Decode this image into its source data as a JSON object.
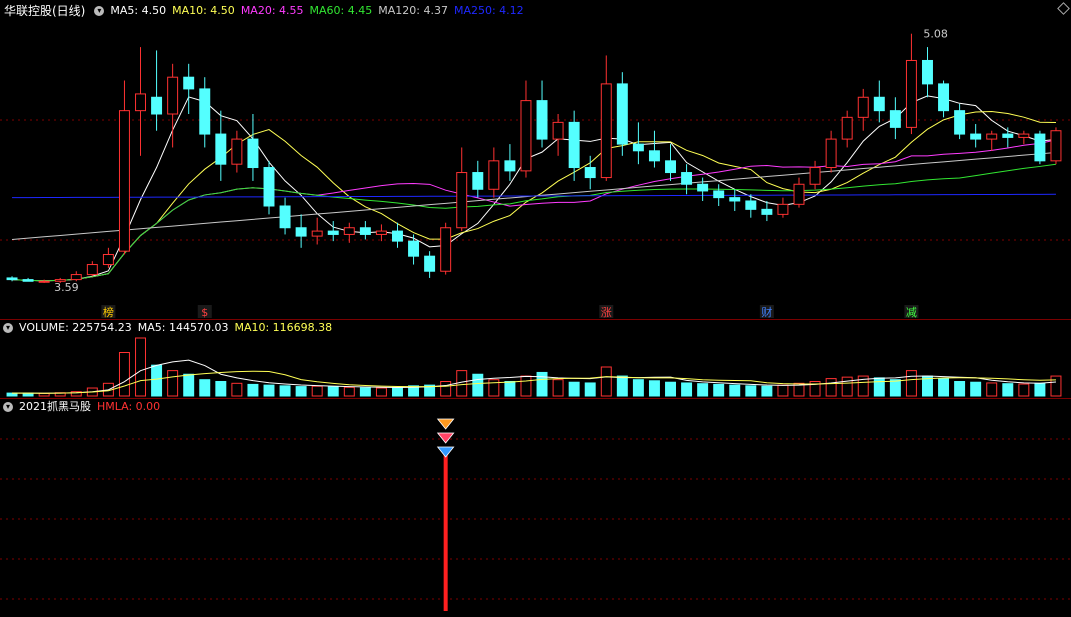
{
  "main_header": {
    "stock_name": "华联控股(日线)",
    "ma5": "MA5: 4.50",
    "ma10": "MA10: 4.50",
    "ma20": "MA20: 4.55",
    "ma60": "MA60: 4.45",
    "ma120": "MA120: 4.37",
    "ma250": "MA250: 4.12"
  },
  "volume_header": {
    "volume": "VOLUME: 225754.23",
    "ma5": "MA5: 144570.03",
    "ma10": "MA10: 116698.38"
  },
  "indicator_header": {
    "name": "2021抓黑马股",
    "hmla": "HMLA: 0.00"
  },
  "colors": {
    "up": "#ff3232",
    "down": "#54ffff",
    "ma5": "#ffffff",
    "ma10": "#ffff55",
    "ma20": "#ff3cff",
    "ma60": "#32e632",
    "ma120": "#c8c8c8",
    "ma250": "#1e28ff",
    "grid": "#800000"
  },
  "chart_data": {
    "type": "candlestick",
    "price_annotations": {
      "high_label": "5.08",
      "low_label": "3.59"
    },
    "event_markers": [
      {
        "index": 6,
        "label": "榜",
        "color": "#ffcc00"
      },
      {
        "index": 12,
        "label": "$",
        "color": "#ff4040"
      },
      {
        "index": 37,
        "label": "涨",
        "color": "#ff4040"
      },
      {
        "index": 47,
        "label": "财",
        "color": "#4080ff"
      },
      {
        "index": 56,
        "label": "减",
        "color": "#40ff40"
      }
    ],
    "signal_index": 27,
    "ohlc": [
      [
        3.62,
        3.63,
        3.6,
        3.61
      ],
      [
        3.61,
        3.62,
        3.6,
        3.6
      ],
      [
        3.6,
        3.61,
        3.59,
        3.6
      ],
      [
        3.6,
        3.62,
        3.59,
        3.61
      ],
      [
        3.61,
        3.66,
        3.6,
        3.64
      ],
      [
        3.64,
        3.72,
        3.63,
        3.7
      ],
      [
        3.7,
        3.8,
        3.68,
        3.76
      ],
      [
        3.78,
        4.8,
        3.76,
        4.62
      ],
      [
        4.62,
        5.0,
        4.35,
        4.72
      ],
      [
        4.7,
        4.98,
        4.5,
        4.6
      ],
      [
        4.6,
        4.9,
        4.4,
        4.82
      ],
      [
        4.82,
        4.9,
        4.6,
        4.75
      ],
      [
        4.75,
        4.82,
        4.4,
        4.48
      ],
      [
        4.48,
        4.62,
        4.2,
        4.3
      ],
      [
        4.3,
        4.5,
        4.25,
        4.45
      ],
      [
        4.45,
        4.6,
        4.2,
        4.28
      ],
      [
        4.28,
        4.32,
        4.0,
        4.05
      ],
      [
        4.05,
        4.1,
        3.88,
        3.92
      ],
      [
        3.92,
        4.0,
        3.8,
        3.87
      ],
      [
        3.87,
        3.98,
        3.82,
        3.9
      ],
      [
        3.9,
        3.96,
        3.84,
        3.88
      ],
      [
        3.88,
        3.95,
        3.83,
        3.92
      ],
      [
        3.92,
        3.96,
        3.85,
        3.88
      ],
      [
        3.88,
        3.94,
        3.84,
        3.9
      ],
      [
        3.9,
        3.95,
        3.8,
        3.84
      ],
      [
        3.84,
        3.88,
        3.7,
        3.75
      ],
      [
        3.75,
        3.78,
        3.62,
        3.66
      ],
      [
        3.66,
        3.95,
        3.64,
        3.92
      ],
      [
        3.92,
        4.4,
        3.9,
        4.25
      ],
      [
        4.25,
        4.32,
        4.1,
        4.15
      ],
      [
        4.15,
        4.4,
        4.1,
        4.32
      ],
      [
        4.32,
        4.42,
        4.2,
        4.26
      ],
      [
        4.26,
        4.8,
        4.22,
        4.68
      ],
      [
        4.68,
        4.8,
        4.4,
        4.45
      ],
      [
        4.45,
        4.6,
        4.35,
        4.55
      ],
      [
        4.55,
        4.62,
        4.2,
        4.28
      ],
      [
        4.28,
        4.35,
        4.15,
        4.22
      ],
      [
        4.22,
        4.95,
        4.2,
        4.78
      ],
      [
        4.78,
        4.85,
        4.35,
        4.42
      ],
      [
        4.42,
        4.55,
        4.3,
        4.38
      ],
      [
        4.38,
        4.5,
        4.28,
        4.32
      ],
      [
        4.32,
        4.42,
        4.2,
        4.25
      ],
      [
        4.25,
        4.3,
        4.12,
        4.18
      ],
      [
        4.18,
        4.22,
        4.08,
        4.14
      ],
      [
        4.14,
        4.18,
        4.05,
        4.1
      ],
      [
        4.1,
        4.15,
        4.02,
        4.08
      ],
      [
        4.08,
        4.12,
        3.98,
        4.03
      ],
      [
        4.03,
        4.08,
        3.96,
        4.0
      ],
      [
        4.0,
        4.1,
        3.98,
        4.06
      ],
      [
        4.06,
        4.22,
        4.04,
        4.18
      ],
      [
        4.18,
        4.32,
        4.15,
        4.28
      ],
      [
        4.28,
        4.5,
        4.25,
        4.45
      ],
      [
        4.45,
        4.62,
        4.4,
        4.58
      ],
      [
        4.58,
        4.75,
        4.5,
        4.7
      ],
      [
        4.7,
        4.8,
        4.55,
        4.62
      ],
      [
        4.62,
        4.7,
        4.45,
        4.52
      ],
      [
        4.52,
        5.08,
        4.48,
        4.92
      ],
      [
        4.92,
        5.0,
        4.7,
        4.78
      ],
      [
        4.78,
        4.8,
        4.58,
        4.62
      ],
      [
        4.62,
        4.66,
        4.45,
        4.48
      ],
      [
        4.48,
        4.54,
        4.4,
        4.45
      ],
      [
        4.45,
        4.5,
        4.38,
        4.48
      ],
      [
        4.48,
        4.52,
        4.4,
        4.46
      ],
      [
        4.46,
        4.5,
        4.42,
        4.48
      ],
      [
        4.48,
        4.5,
        4.3,
        4.32
      ],
      [
        4.32,
        4.52,
        4.3,
        4.5
      ]
    ],
    "volume": [
      8,
      8,
      7,
      9,
      12,
      22,
      35,
      120,
      160,
      85,
      70,
      60,
      45,
      40,
      35,
      32,
      30,
      28,
      26,
      27,
      25,
      24,
      23,
      22,
      24,
      28,
      30,
      40,
      70,
      60,
      45,
      40,
      55,
      65,
      45,
      38,
      36,
      80,
      55,
      45,
      42,
      38,
      36,
      34,
      32,
      30,
      28,
      27,
      30,
      35,
      40,
      48,
      52,
      55,
      50,
      45,
      70,
      55,
      48,
      40,
      38,
      36,
      34,
      33,
      35,
      55
    ]
  }
}
